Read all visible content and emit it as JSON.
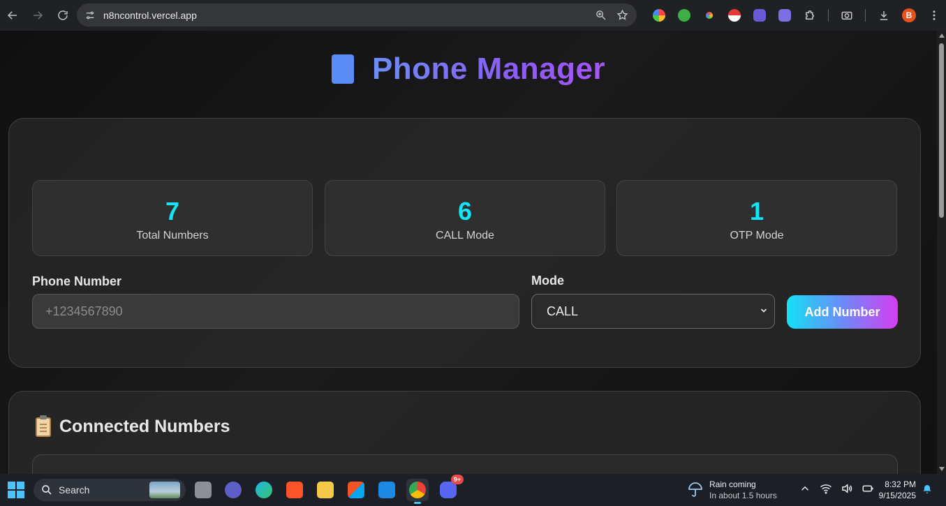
{
  "browser": {
    "url": "n8ncontrol.vercel.app",
    "profile_initial": "B"
  },
  "app": {
    "title": "Phone Manager",
    "icon": "phone-icon"
  },
  "stats": [
    {
      "value": "7",
      "label": "Total Numbers"
    },
    {
      "value": "6",
      "label": "CALL Mode"
    },
    {
      "value": "1",
      "label": "OTP Mode"
    }
  ],
  "form": {
    "phone_label": "Phone Number",
    "phone_placeholder": "+1234567890",
    "phone_value": "",
    "mode_label": "Mode",
    "mode_value": "CALL",
    "add_button": "Add Number"
  },
  "connected": {
    "title": "Connected Numbers",
    "icon": "clipboard-icon"
  },
  "taskbar": {
    "search_text": "Search",
    "discord_badge": "9+",
    "weather_title": "Rain coming",
    "weather_sub": "In about 1.5 hours",
    "time": "8:32 PM",
    "date": "9/15/2025"
  },
  "colors": {
    "accent_cyan": "#14e5f5",
    "title_gradient_start": "#6a8ff7",
    "title_gradient_end": "#a855f7",
    "button_gradient_start": "#14e0f5",
    "button_gradient_end": "#d63df2"
  }
}
